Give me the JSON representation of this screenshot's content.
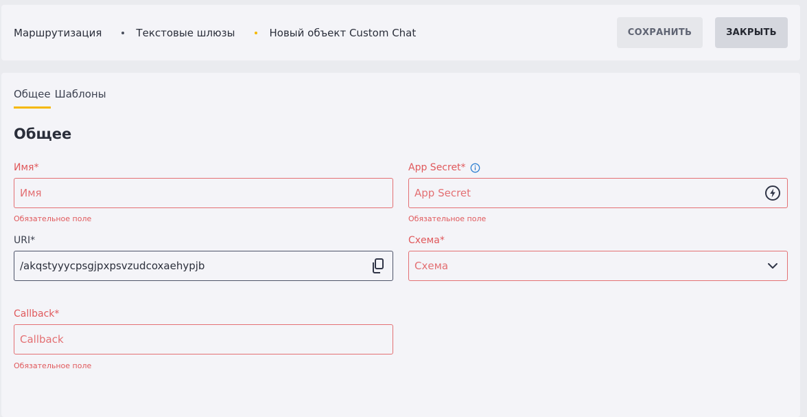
{
  "header": {
    "breadcrumb": [
      "Маршрутизация",
      "Текстовые шлюзы",
      "Новый объект Custom Chat"
    ],
    "save_label": "СОХРАНИТЬ",
    "close_label": "ЗАКРЫТЬ"
  },
  "tabs": [
    {
      "label": "Общее",
      "active": true
    },
    {
      "label": "Шаблоны",
      "active": false
    }
  ],
  "section_title": "Общее",
  "fields": {
    "name": {
      "label": "Имя*",
      "placeholder": "Имя",
      "value": "",
      "error": "Обязательное поле"
    },
    "app_secret": {
      "label": "App Secret*",
      "placeholder": "App Secret",
      "value": "",
      "error": "Обязательное поле",
      "label_icon": "info-icon",
      "action_icon": "lightning-icon"
    },
    "uri": {
      "label": "URI*",
      "value": "/akqstyyycpsgjpxpsvzudcoxaehypjb",
      "action_icon": "copy-icon"
    },
    "scheme": {
      "label": "Схема*",
      "placeholder": "Схема",
      "action_icon": "chevron-down-icon"
    },
    "callback": {
      "label": "Callback*",
      "placeholder": "Callback",
      "value": "",
      "error": "Обязательное поле"
    }
  },
  "colors": {
    "accent": "#f5b800",
    "error": "#e0585b",
    "info": "#2f80d1"
  }
}
